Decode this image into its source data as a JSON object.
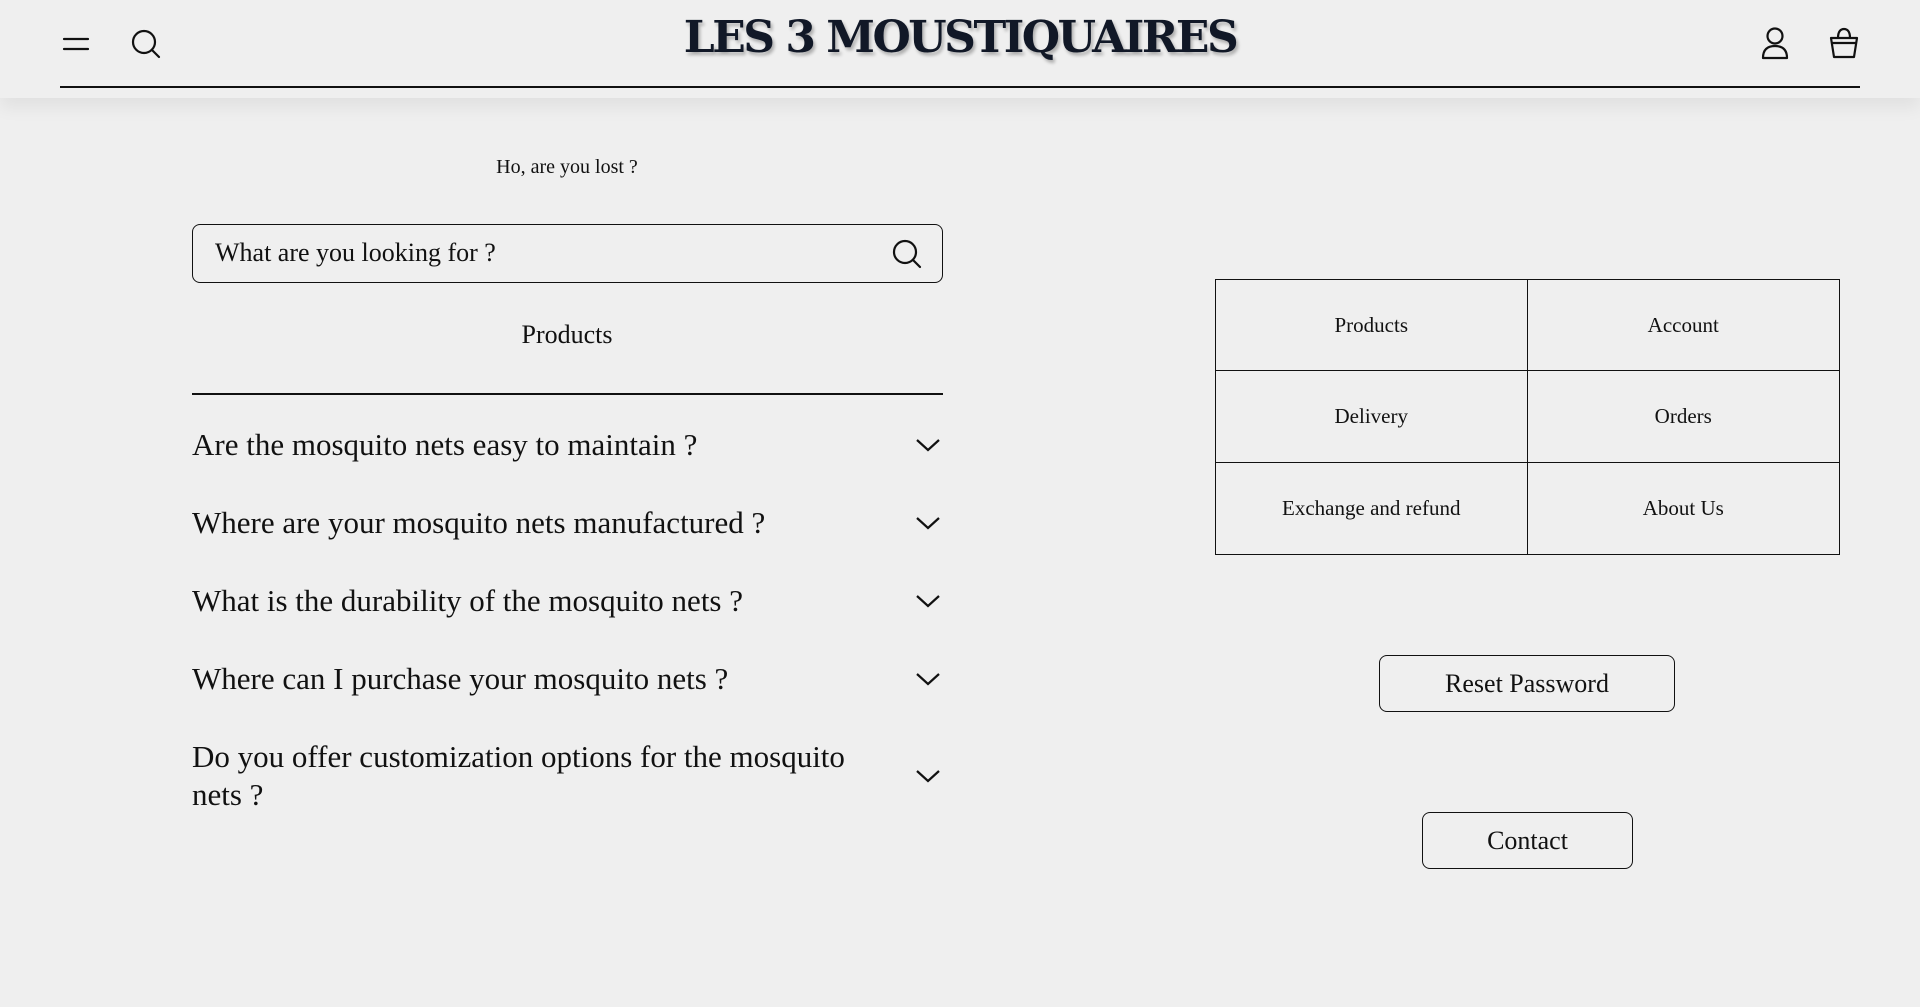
{
  "header": {
    "brand": "LES 3 MOUSTIQUAIRES",
    "icons": {
      "menu": "hamburger-menu-icon",
      "search": "search-icon",
      "account": "user-icon",
      "cart": "basket-icon"
    }
  },
  "notfound": {
    "message": "Ho, are you lost ?"
  },
  "search": {
    "placeholder": "What are you looking for ?",
    "value": ""
  },
  "faq": {
    "section_title": "Products",
    "questions": [
      "Are the mosquito nets easy to maintain ?",
      "Where are your mosquito nets manufactured ?",
      "What is the durability of the mosquito nets ?",
      "Where can I purchase your mosquito nets ?",
      "Do you offer customization options for the mosquito nets ?"
    ]
  },
  "links": {
    "items": [
      "Products",
      "Account",
      "Delivery",
      "Orders",
      "Exchange and refund",
      "About Us"
    ]
  },
  "buttons": {
    "reset_password": "Reset Password",
    "contact": "Contact"
  },
  "colors": {
    "background": "#efefef",
    "text": "#111111",
    "brand": "#111827"
  }
}
